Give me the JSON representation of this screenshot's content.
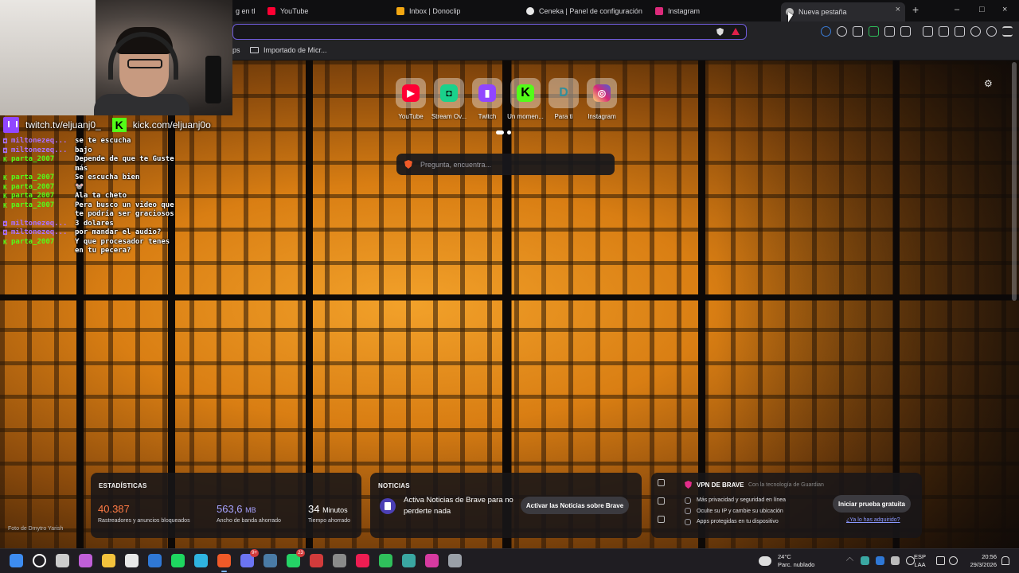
{
  "browser": {
    "tabs": [
      {
        "label": "g en tk",
        "color": "#888888"
      },
      {
        "label": "YouTube",
        "color": "#ff0033"
      },
      {
        "label": "Inbox | Donoclip",
        "color": "#f3a712"
      },
      {
        "label": "Ceneka | Panel de configuración",
        "color": "#e8e8e8"
      },
      {
        "label": "Instagram",
        "color": "#dd2a7b"
      },
      {
        "label": "Nueva pestaña",
        "color": "#bbbbbb",
        "active": true
      }
    ],
    "new_tab_symbol": "+",
    "close_symbol": "×",
    "window_controls": [
      "–",
      "□",
      "×"
    ],
    "bookmarks": [
      {
        "label": "ps"
      },
      {
        "label": "Importado de Micr..."
      }
    ]
  },
  "newtab": {
    "top_sites": [
      {
        "label": "YouTube",
        "glyph": "▶",
        "color": "#ff0033"
      },
      {
        "label": "Stream Ov...",
        "glyph": "◘",
        "color": "#1ad18b"
      },
      {
        "label": "Twitch",
        "glyph": "▮",
        "color": "#9146ff"
      },
      {
        "label": "Un momen...",
        "glyph": "K",
        "color": "#53fc18"
      },
      {
        "label": "Para ti",
        "glyph": "D",
        "color": "#2f8f9d"
      },
      {
        "label": "Instagram",
        "glyph": "◎",
        "color": "#d62976"
      }
    ],
    "settings_icon": "⚙",
    "search_placeholder": "Pregunta, encuentra...",
    "stats": {
      "title": "ESTADÍSTICAS",
      "trackers_value": "40.387",
      "trackers_label": "Rastreadores y anuncios bloqueados",
      "bandwidth_value": "563,6",
      "bandwidth_unit": "MB",
      "bandwidth_label": "Ancho de banda ahorrado",
      "time_value": "34",
      "time_unit": "Minutos",
      "time_label": "Tiempo ahorrado"
    },
    "news": {
      "title": "NOTICIAS",
      "text": "Activa Noticias de Brave para no perderte nada",
      "button": "Activar las Noticias sobre Brave"
    },
    "vpn": {
      "title": "VPN DE BRAVE",
      "tech": "Con la tecnología de  Guardian",
      "features": [
        "Más privacidad y seguridad en línea",
        "Oculte su IP y cambie su ubicación",
        "Apps protegidas en tu dispositivo"
      ],
      "button": "Iniciar prueba gratuita",
      "link": "¿Ya lo has adquirido?"
    },
    "photo_credit": "Foto de Dmytro Yarish"
  },
  "stream": {
    "twitch_handle": "twitch.tv/eljuanj0_",
    "kick_handle": "kick.com/eljuanj0o",
    "chat": [
      {
        "platform": "twitch",
        "user": "miltonezeq...",
        "text": "se te escucha"
      },
      {
        "platform": "twitch",
        "user": "miltonezeq...",
        "text": "bajo"
      },
      {
        "platform": "kick",
        "user": "parta_2007",
        "text": "Depende de que te Guste más"
      },
      {
        "platform": "kick",
        "user": "parta_2007",
        "text": "Se escucha bien"
      },
      {
        "platform": "kick",
        "user": "parta_2007",
        "text": "🐭"
      },
      {
        "platform": "kick",
        "user": "parta_2007",
        "text": "Ala ta cheto"
      },
      {
        "platform": "kick",
        "user": "parta_2007",
        "text": "Pera busco un video que te podría ser graciosos"
      },
      {
        "platform": "twitch",
        "user": "miltonezeq...",
        "text": "3 dolares"
      },
      {
        "platform": "twitch",
        "user": "miltonezeq...",
        "text": "por mandar el audio?"
      },
      {
        "platform": "kick",
        "user": "parta_2007",
        "text": "Y que procesador tenes en tu pecera?"
      }
    ],
    "platform_colors": {
      "twitch": "#a970ff",
      "kick": "#53fc18"
    },
    "platform_glyphs": {
      "twitch": "◘",
      "kick": "K"
    }
  },
  "taskbar": {
    "apps": [
      {
        "name": "start-button",
        "color": "#3d8cf0"
      },
      {
        "name": "search-button",
        "color": "#ffffff"
      },
      {
        "name": "task-view-button",
        "color": "#cccccc"
      },
      {
        "name": "copilot",
        "color": "#c05fd8"
      },
      {
        "name": "file-explorer",
        "color": "#f3c23c"
      },
      {
        "name": "microsoft-store",
        "color": "#e8e8e8"
      },
      {
        "name": "app-blue",
        "color": "#2f78d6"
      },
      {
        "name": "spotify",
        "color": "#1ed760"
      },
      {
        "name": "edge",
        "color": "#2fb4e0"
      },
      {
        "name": "brave",
        "color": "#f05a28",
        "active": true
      },
      {
        "name": "discord",
        "color": "#6b74f2",
        "badge": "9+"
      },
      {
        "name": "steam",
        "color": "#4a7ba6"
      },
      {
        "name": "whatsapp",
        "color": "#25d366",
        "badge": "23"
      },
      {
        "name": "app-red",
        "color": "#d23b3b"
      },
      {
        "name": "obs",
        "color": "#8a8a8a"
      },
      {
        "name": "tiktok",
        "color": "#ee1d52"
      },
      {
        "name": "app-green",
        "color": "#2fbf5b"
      },
      {
        "name": "app-monitor",
        "color": "#3aa7a2"
      },
      {
        "name": "app-pink",
        "color": "#d63aa0"
      },
      {
        "name": "settings",
        "color": "#9aa0a8"
      }
    ],
    "weather_temp": "24°C",
    "weather_desc": "Parc. nublado",
    "lang_line1": "ESP",
    "lang_line2": "LAA",
    "time": "20:56",
    "date": "29/3/2026"
  }
}
